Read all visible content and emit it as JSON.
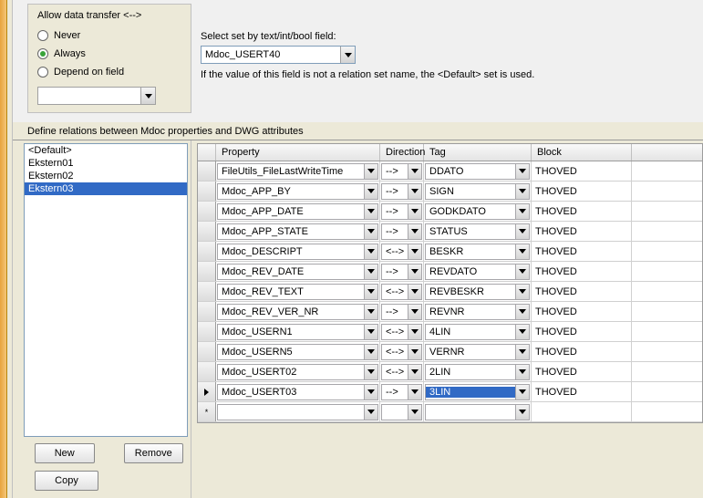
{
  "transfer": {
    "title": "Allow data transfer <-->",
    "options": {
      "never": "Never",
      "always": "Always",
      "depend": "Depend on field"
    },
    "selected": "always",
    "depend_value": ""
  },
  "select_set": {
    "label": "Select set by text/int/bool field:",
    "value": "Mdoc_USERT40",
    "hint": "If the value of this field is not a relation set name, the <Default> set is used."
  },
  "section_label": "Define relations between Mdoc properties and DWG attributes",
  "sets": {
    "items": [
      "<Default>",
      "Ekstern01",
      "Ekstern02",
      "Ekstern03"
    ],
    "selected_index": 3
  },
  "buttons": {
    "new": "New",
    "remove": "Remove",
    "copy": "Copy"
  },
  "grid": {
    "headers": {
      "property": "Property",
      "direction": "Direction",
      "tag": "Tag",
      "block": "Block"
    },
    "rows": [
      {
        "property": "FileUtils_FileLastWriteTime",
        "direction": "-->",
        "tag": "DDATO",
        "block": "THOVED"
      },
      {
        "property": "Mdoc_APP_BY",
        "direction": "-->",
        "tag": "SIGN",
        "block": "THOVED"
      },
      {
        "property": "Mdoc_APP_DATE",
        "direction": "-->",
        "tag": "GODKDATO",
        "block": "THOVED"
      },
      {
        "property": "Mdoc_APP_STATE",
        "direction": "-->",
        "tag": "STATUS",
        "block": "THOVED"
      },
      {
        "property": "Mdoc_DESCRIPT",
        "direction": "<-->",
        "tag": "BESKR",
        "block": "THOVED"
      },
      {
        "property": "Mdoc_REV_DATE",
        "direction": "-->",
        "tag": "REVDATO",
        "block": "THOVED"
      },
      {
        "property": "Mdoc_REV_TEXT",
        "direction": "<-->",
        "tag": "REVBESKR",
        "block": "THOVED"
      },
      {
        "property": "Mdoc_REV_VER_NR",
        "direction": "-->",
        "tag": "REVNR",
        "block": "THOVED"
      },
      {
        "property": "Mdoc_USERN1",
        "direction": "<-->",
        "tag": "4LIN",
        "block": "THOVED"
      },
      {
        "property": "Mdoc_USERN5",
        "direction": "<-->",
        "tag": "VERNR",
        "block": "THOVED"
      },
      {
        "property": "Mdoc_USERT02",
        "direction": "<-->",
        "tag": "2LIN",
        "block": "THOVED"
      },
      {
        "property": "Mdoc_USERT03",
        "direction": "-->",
        "tag": "3LIN",
        "block": "THOVED",
        "current": true,
        "tag_highlight": true
      }
    ]
  }
}
